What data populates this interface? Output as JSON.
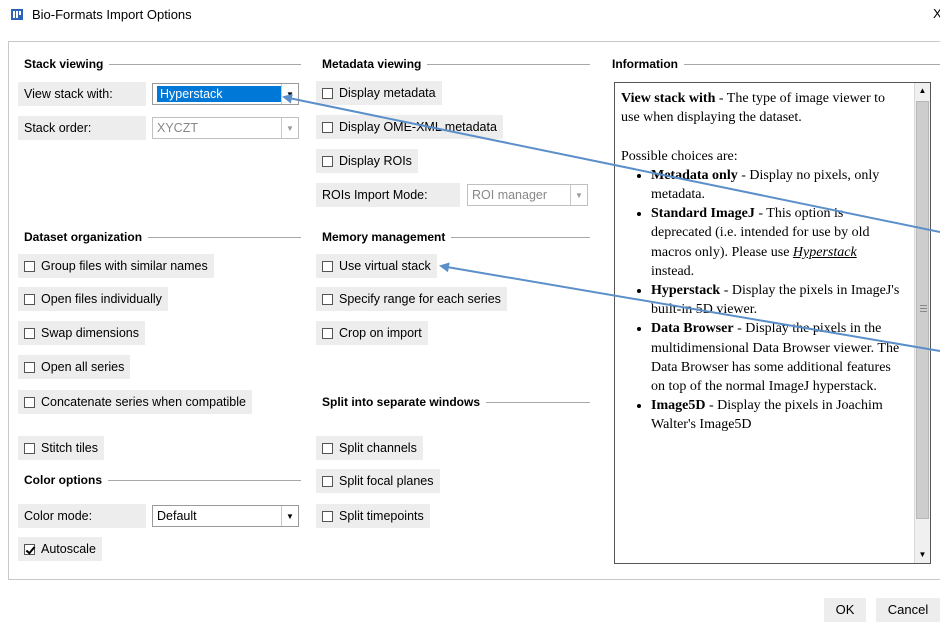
{
  "window": {
    "title": "Bio-Formats Import Options",
    "close_glyph": "X"
  },
  "stack_viewing": {
    "title": "Stack viewing",
    "view_stack_label": "View stack with:",
    "view_stack_value": "Hyperstack",
    "stack_order_label": "Stack order:",
    "stack_order_value": "XYCZT"
  },
  "metadata_viewing": {
    "title": "Metadata viewing",
    "display_metadata": "Display metadata",
    "display_ome_xml": "Display OME-XML metadata",
    "display_rois": "Display ROIs",
    "rois_mode_label": "ROIs Import Mode:",
    "rois_mode_value": "ROI manager"
  },
  "information": {
    "title": "Information",
    "heading": "View stack with",
    "heading_rest": " - The type of image viewer to use when displaying the dataset.",
    "choices_intro": "Possible choices are:",
    "items": [
      {
        "name": "Metadata only",
        "desc": " - Display no pixels, only metadata."
      },
      {
        "name": "Standard ImageJ",
        "desc_before": " - This option is deprecated (i.e. intended for use by old macros only). Please use ",
        "link": "Hyperstack",
        "desc_after": " instead."
      },
      {
        "name": "Hyperstack",
        "desc": " - Display the pixels in ImageJ's built-in 5D viewer."
      },
      {
        "name": "Data Browser",
        "desc": " - Display the pixels in the multidimensional Data Browser viewer. The Data Browser has some additional features on top of the normal ImageJ hyperstack."
      },
      {
        "name": "Image5D",
        "desc": " - Display the pixels in Joachim Walter's Image5D"
      }
    ]
  },
  "dataset_organization": {
    "title": "Dataset organization",
    "group_files": "Group files with similar names",
    "open_individually": "Open files individually",
    "swap_dimensions": "Swap dimensions",
    "open_all_series": "Open all series",
    "concatenate": "Concatenate series when compatible",
    "stitch_tiles": "Stitch tiles"
  },
  "memory_management": {
    "title": "Memory management",
    "use_virtual_stack": "Use virtual stack",
    "specify_range": "Specify range for each series",
    "crop_on_import": "Crop on import"
  },
  "split_windows": {
    "title": "Split into separate windows",
    "split_channels": "Split channels",
    "split_focal_planes": "Split focal planes",
    "split_timepoints": "Split timepoints"
  },
  "color_options": {
    "title": "Color options",
    "color_mode_label": "Color mode:",
    "color_mode_value": "Default",
    "autoscale": "Autoscale"
  },
  "buttons": {
    "ok": "OK",
    "cancel": "Cancel"
  },
  "colors": {
    "annotation_arrow": "#5b8fc9",
    "selection": "#0078d7",
    "label_bg": "#ededed"
  }
}
